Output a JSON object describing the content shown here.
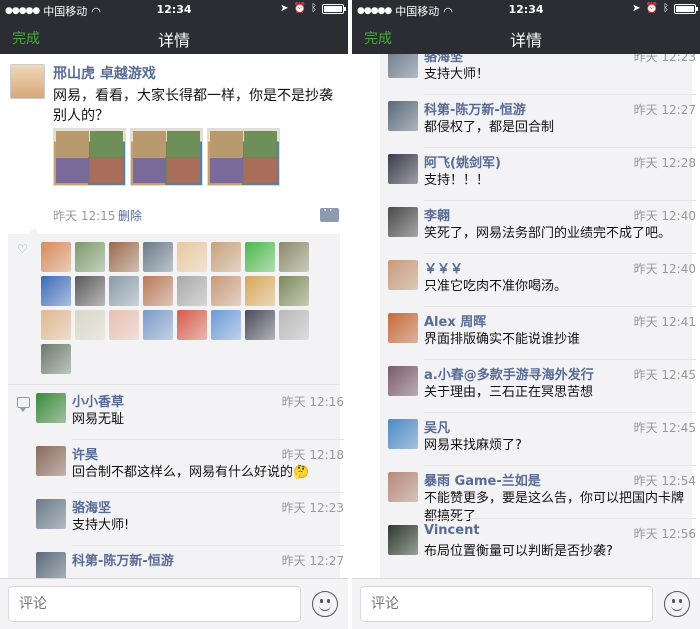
{
  "status": {
    "carrier": "中国移动",
    "time": "12:34"
  },
  "nav": {
    "done_label": "完成",
    "title": "详情"
  },
  "post": {
    "author": "邢山虎 卓越游戏",
    "text": "网易，看看，大家长得都一样，你是不是抄袭别人的？",
    "time": "昨天 12:15",
    "delete_label": "删除"
  },
  "like_colors": [
    "#d98a5a",
    "#7a9a6a",
    "#9a6a4a",
    "#6a7a8a",
    "#e8c8a0",
    "#c8a07a",
    "#4ab84a",
    "#8a8a6a",
    "#3a6ab8",
    "#5a5a5a",
    "#8a9aa8",
    "#b87a5a",
    "#a8a8a8",
    "#c89a7a",
    "#d8a85a",
    "#7a8a5a",
    "#e0b890",
    "#d8d8c8",
    "#e8c0b0",
    "#7a9ac8",
    "#d85a4a",
    "#6a9ad8",
    "#4a4a5a",
    "#b8b8b8",
    "#6a7a6a"
  ],
  "comment_input": {
    "placeholder": "评论"
  },
  "left_comments": [
    {
      "name": "小小香草",
      "time": "昨天 12:16",
      "text": "网易无耻",
      "color": "#3a8a3a"
    },
    {
      "name": "许昊",
      "time": "昨天 12:18",
      "text": "回合制不都这样么，网易有什么好说的🤔",
      "color": "#8a6a5a"
    },
    {
      "name": "骆海坚",
      "time": "昨天 12:23",
      "text": "支持大师!",
      "color": "#6a7a8a"
    },
    {
      "name": "科第-陈万新-恒游",
      "time": "昨天 12:27",
      "text": "",
      "color": "#5a6a7a"
    }
  ],
  "right_comments": [
    {
      "name": "骆海坚",
      "time": "昨天 12:23",
      "text": "支持大师！",
      "color": "#6a7a8a"
    },
    {
      "name": "科第-陈万新-恒游",
      "time": "昨天 12:27",
      "text": "都侵权了，都是回合制",
      "color": "#5a6a7a"
    },
    {
      "name": "阿飞(姚剑军)",
      "time": "昨天 12:28",
      "text": "支持！！！",
      "color": "#3a3a4a"
    },
    {
      "name": "李翱",
      "time": "昨天 12:40",
      "text": "笑死了，网易法务部门的业绩完不成了吧。",
      "color": "#4a4a4a"
    },
    {
      "name": "￥￥￥",
      "time": "昨天 12:40",
      "text": "只准它吃肉不准你喝汤。",
      "color": "#c89a7a"
    },
    {
      "name": "Alex 周晖",
      "time": "昨天 12:41",
      "text": "界面排版确实不能说谁抄谁",
      "color": "#c86a3a"
    },
    {
      "name": "a.小春@多款手游寻海外发行",
      "time": "昨天 12:45",
      "text": "关于理由，三石正在冥思苦想",
      "color": "#7a5a6a"
    },
    {
      "name": "吴凡",
      "time": "昨天 12:45",
      "text": "网易来找麻烦了?",
      "color": "#4a8ac8"
    },
    {
      "name": "暴雨 Game-兰如是",
      "time": "昨天 12:54",
      "text": "不能赞更多，要是这么告，你可以把国内卡牌都搞死了",
      "color": "#b88a7a"
    },
    {
      "name": "Vincent",
      "time": "昨天 12:56",
      "text": "布局位置衡量可以判断是否抄袭?",
      "color": "#2a3a2a"
    }
  ]
}
